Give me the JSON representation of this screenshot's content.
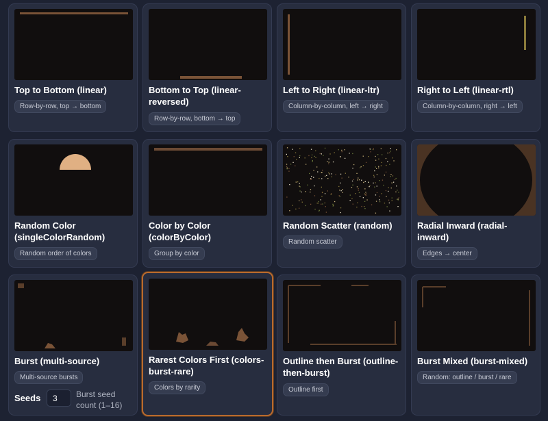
{
  "colors": {
    "page_bg": "#1d2232",
    "card_bg": "#272d3f",
    "preview_bg": "#110e0e",
    "paint": "#7a5337",
    "selected_border": "#b86a2e"
  },
  "cards": [
    {
      "title": "Top to Bottom (linear)",
      "chip": "Row-by-row, top → bottom"
    },
    {
      "title": "Bottom to Top (linear-reversed)",
      "chip": "Row-by-row, bottom → top"
    },
    {
      "title": "Left to Right (linear-ltr)",
      "chip": "Column-by-column, left → right"
    },
    {
      "title": "Right to Left (linear-rtl)",
      "chip": "Column-by-column, right → left"
    },
    {
      "title": "Random Color (singleColorRandom)",
      "chip": "Random order of colors"
    },
    {
      "title": "Color by Color (colorByColor)",
      "chip": "Group by color"
    },
    {
      "title": "Random Scatter (random)",
      "chip": "Random scatter"
    },
    {
      "title": "Radial Inward (radial-inward)",
      "chip": "Edges → center"
    },
    {
      "title": "Burst (multi-source)",
      "chip": "Multi-source bursts"
    },
    {
      "title": "Rarest Colors First (colors-burst-rare)",
      "chip": "Colors by rarity"
    },
    {
      "title": "Outline then Burst (outline-then-burst)",
      "chip": "Outline first"
    },
    {
      "title": "Burst Mixed (burst-mixed)",
      "chip": "Random: outline / burst / rare"
    }
  ],
  "seeds": {
    "label": "Seeds",
    "value": "3",
    "help": "Burst seed count (1–16)"
  },
  "selected_card": "Rarest Colors First (colors-burst-rare)"
}
